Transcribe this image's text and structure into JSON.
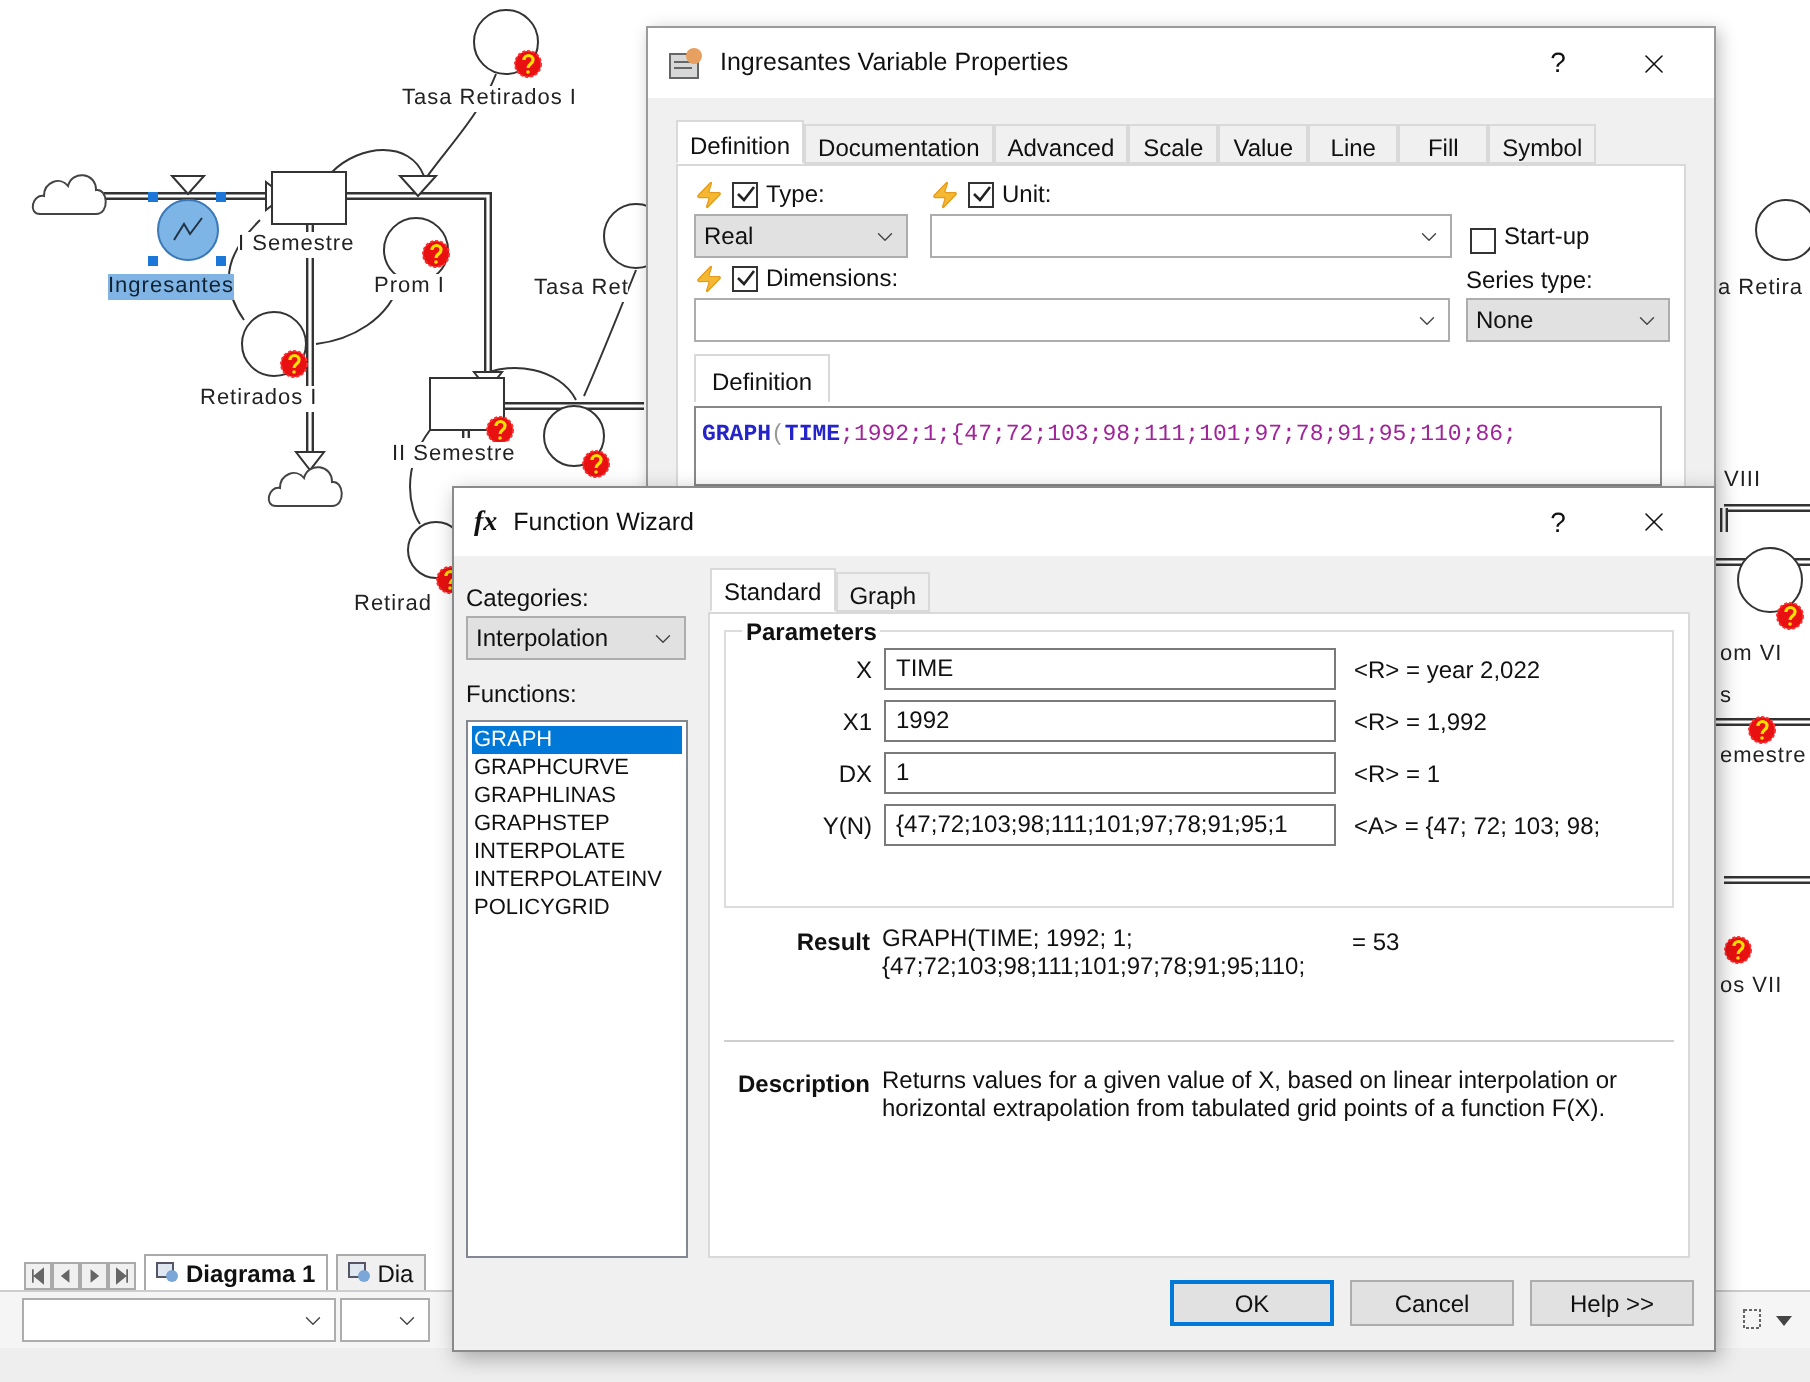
{
  "diagram": {
    "labels": [
      {
        "text": "Tasa Retirados I",
        "selected": false
      },
      {
        "text": "I Semestre",
        "selected": false
      },
      {
        "text": "Ingresantes",
        "selected": true
      },
      {
        "text": "Prom I",
        "selected": false
      },
      {
        "text": "Tasa Ret",
        "selected": false
      },
      {
        "text": "Retirados I",
        "selected": false
      },
      {
        "text": "II Semestre",
        "selected": false
      },
      {
        "text": "Retirad",
        "selected": false
      },
      {
        "text": "a Retira",
        "selected": false
      },
      {
        "text": "VIII",
        "selected": false
      },
      {
        "text": "om VI",
        "selected": false
      },
      {
        "text": "s",
        "selected": false
      },
      {
        "text": "emestre",
        "selected": false
      },
      {
        "text": "os VII",
        "selected": false
      }
    ]
  },
  "properties_dialog": {
    "title": "Ingresantes Variable Properties",
    "help": "?",
    "tabs": [
      {
        "label": "Definition",
        "selected": true
      },
      {
        "label": "Documentation",
        "selected": false
      },
      {
        "label": "Advanced",
        "selected": false
      },
      {
        "label": "Scale",
        "selected": false
      },
      {
        "label": "Value",
        "selected": false
      },
      {
        "label": "Line",
        "selected": false
      },
      {
        "label": "Fill",
        "selected": false
      },
      {
        "label": "Symbol",
        "selected": false
      }
    ],
    "type": {
      "label": "Type:",
      "checked": true,
      "value": "Real"
    },
    "unit": {
      "label": "Unit:",
      "checked": true
    },
    "startup": {
      "label": "Start-up",
      "checked": false
    },
    "dimensions": {
      "label": "Dimensions:",
      "checked": true
    },
    "series_type": {
      "label": "Series type:",
      "value": "None"
    },
    "definition": {
      "tab": "Definition",
      "text": "GRAPH(TIME;1992;1;{47;72;103;98;111;101;97;78;91;95;110;86;"
    }
  },
  "function_wizard": {
    "icon": "fx",
    "title": "Function Wizard",
    "help": "?",
    "categories_label": "Categories:",
    "category": "Interpolation",
    "functions_label": "Functions:",
    "functions": [
      {
        "name": "GRAPH",
        "selected": true
      },
      {
        "name": "GRAPHCURVE",
        "selected": false
      },
      {
        "name": "GRAPHLINAS",
        "selected": false
      },
      {
        "name": "GRAPHSTEP",
        "selected": false
      },
      {
        "name": "INTERPOLATE",
        "selected": false
      },
      {
        "name": "INTERPOLATEINV",
        "selected": false
      },
      {
        "name": "POLICYGRID",
        "selected": false
      }
    ],
    "tabs": [
      {
        "label": "Standard",
        "selected": true
      },
      {
        "label": "Graph",
        "selected": false
      }
    ],
    "parameters_title": "Parameters",
    "parameters": [
      {
        "name": "X",
        "value": "TIME",
        "reading": "<R> = year 2,022"
      },
      {
        "name": "X1",
        "value": "1992",
        "reading": "<R> = 1,992"
      },
      {
        "name": "DX",
        "value": "1",
        "reading": "<R> = 1"
      },
      {
        "name": "Y(N)",
        "value": "{47;72;103;98;111;101;97;78;91;95;1",
        "reading": "<A> = {47; 72; 103; 98;"
      }
    ],
    "result_label": "Result",
    "result_lines": [
      "GRAPH(TIME; 1992; 1;",
      "{47;72;103;98;111;101;97;78;91;95;110;"
    ],
    "result_value": "= 53",
    "description_label": "Description",
    "description": "Returns values for a given value of X, based on linear interpolation or horizontal extrapolation from tabulated grid points of a function F(X).",
    "buttons": [
      {
        "label": "OK",
        "default": true
      },
      {
        "label": "Cancel",
        "default": false
      },
      {
        "label": "Help >>",
        "default": false
      }
    ]
  },
  "sheet_tabs": [
    {
      "label": "Diagrama 1",
      "selected": true
    },
    {
      "label": "Dia",
      "selected": false
    }
  ]
}
